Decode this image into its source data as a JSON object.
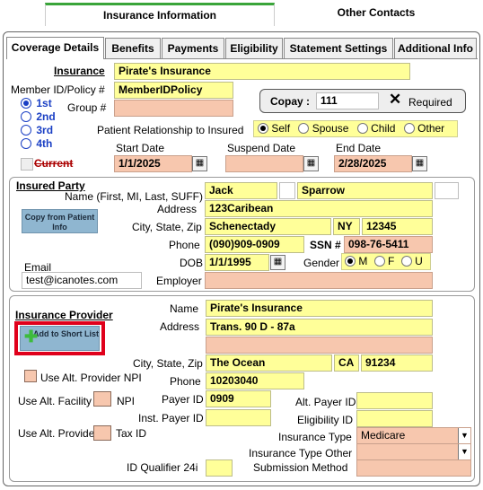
{
  "top_tabs": [
    {
      "label": "Insurance Information",
      "active": true
    },
    {
      "label": "Other Contacts",
      "active": false
    }
  ],
  "sub_tabs": [
    "Coverage Details",
    "Benefits",
    "Payments",
    "Eligibility",
    "Statement Settings",
    "Additional Info"
  ],
  "coverage": {
    "insurance_label": "Insurance",
    "insurance_value": "Pirate's Insurance",
    "member_label": "Member ID/Policy #",
    "member_value": "MemberIDPolicy",
    "group_label": "Group #",
    "group_value": "",
    "priority": [
      "1st",
      "2nd",
      "3rd",
      "4th"
    ],
    "copay_label": "Copay :",
    "copay_value": "111",
    "required_label": "Required",
    "relationship_label": "Patient Relationship to Insured",
    "relationship_options": [
      "Self",
      "Spouse",
      "Child",
      "Other"
    ],
    "current_label": "Current",
    "start_label": "Start Date",
    "start_value": "1/1/2025",
    "suspend_label": "Suspend Date",
    "suspend_value": "",
    "end_label": "End Date",
    "end_value": "2/28/2025"
  },
  "insured": {
    "title": "Insured Party",
    "name_label": "Name (First, MI, Last, SUFF)",
    "first": "Jack",
    "mi": "",
    "last": "Sparrow",
    "suffix": "",
    "copy_button": "Copy from Patient Info",
    "address_label": "Address",
    "address": "123Caribean",
    "csz_label": "City, State, Zip",
    "city": "Schenectady",
    "state": "NY",
    "zip": "12345",
    "phone_label": "Phone",
    "phone": "(090)909-0909",
    "ssn_label": "SSN #",
    "ssn": "098-76-5411",
    "email_label": "Email",
    "email": "test@icanotes.com",
    "dob_label": "DOB",
    "dob": "1/1/1995",
    "gender_label": "Gender",
    "gender_options": [
      "M",
      "F",
      "U"
    ],
    "employer_label": "Employer",
    "employer": ""
  },
  "provider": {
    "title": "Insurance Provider",
    "add_button": "Add to Short List",
    "name_label": "Name",
    "name": "Pirate's Insurance",
    "address_label": "Address",
    "address1": "Trans. 90 D - 87a",
    "address2": "",
    "csz_label": "City, State, Zip",
    "city": "The Ocean",
    "state": "CA",
    "zip": "91234",
    "phone_label": "Phone",
    "phone": "10203040",
    "alt_npi_label": "Use Alt. Provider NPI",
    "alt_facility_label": "Use Alt. Facility",
    "npi_label": "NPI",
    "alt_provider_label": "Use Alt. Provider",
    "taxid_label": "Tax ID",
    "payer_id_label": "Payer ID",
    "payer_id": "0909",
    "inst_payer_label": "Inst. Payer ID",
    "inst_payer": "",
    "alt_payer_label": "Alt. Payer ID",
    "alt_payer": "",
    "eligibility_label": "Eligibility ID",
    "eligibility": "",
    "ins_type_label": "Insurance Type",
    "ins_type": "Medicare",
    "ins_type_other_label": "Insurance Type Other",
    "ins_type_other": "",
    "submission_label": "Submission Method",
    "submission": "",
    "qualifier_label": "ID Qualifier 24i",
    "qualifier": ""
  },
  "colors": {
    "yellow_field": "#ffff99",
    "pink_field": "#f7c7ae",
    "highlight_red": "#e0001b",
    "tab_green": "#4caf50"
  }
}
